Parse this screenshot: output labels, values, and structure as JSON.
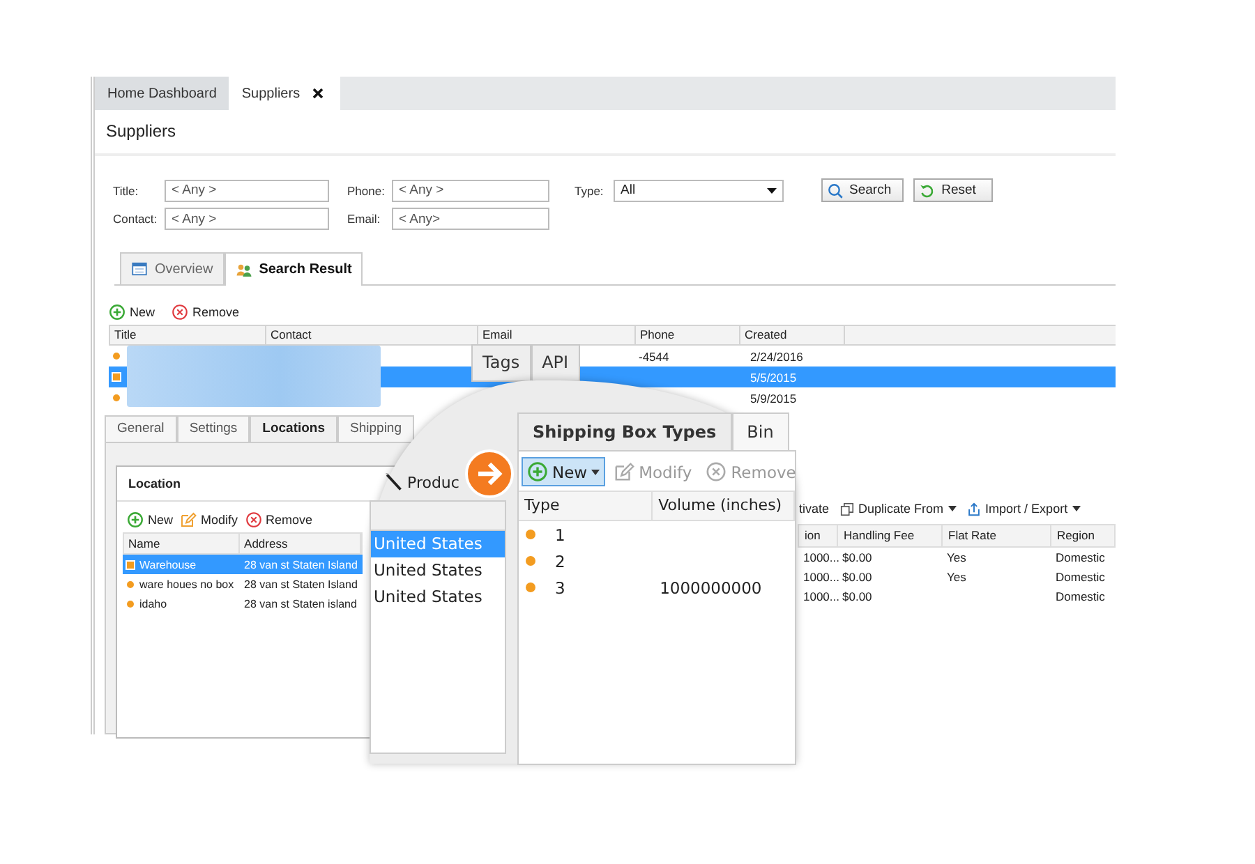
{
  "tabs": [
    {
      "label": "Home Dashboard",
      "selected": false
    },
    {
      "label": "Suppliers",
      "selected": true,
      "closable": true
    }
  ],
  "page_title": "Suppliers",
  "filters": [
    {
      "label": "Title:",
      "placeholder": "< Any >",
      "kind": "text"
    },
    {
      "label": "Phone:",
      "placeholder": "< Any >",
      "kind": "text"
    },
    {
      "label": "Type:",
      "value": "All",
      "kind": "select"
    },
    {
      "label": "Contact:",
      "placeholder": "< Any >",
      "kind": "text"
    },
    {
      "label": "Email:",
      "placeholder": "< Any>",
      "kind": "text"
    }
  ],
  "filter_buttons": [
    {
      "label": "Search",
      "kind": "search"
    },
    {
      "label": "Reset",
      "kind": "reset"
    }
  ],
  "view_tabs": [
    {
      "label": "Overview",
      "selected": false,
      "kind": "calendar"
    },
    {
      "label": "Search Result",
      "selected": true,
      "kind": "people"
    }
  ],
  "result_toolbar": [
    {
      "label": "New",
      "kind": "add"
    },
    {
      "label": "Remove",
      "kind": "remove"
    }
  ],
  "results": {
    "columns": [
      "Title",
      "Contact",
      "Email",
      "Phone",
      "Created"
    ],
    "rows": [
      {
        "phone": "-4544",
        "created": "2/24/2016",
        "selected": false
      },
      {
        "created": "5/5/2015",
        "selected": true
      },
      {
        "created": "5/9/2015",
        "selected": false
      }
    ]
  },
  "detail_tabs": [
    {
      "label": "General",
      "selected": false
    },
    {
      "label": "Settings",
      "selected": false
    },
    {
      "label": "Locations",
      "selected": true
    },
    {
      "label": "Shipping",
      "selected": false
    }
  ],
  "location_panel": {
    "title": "Location",
    "toolbar": [
      {
        "label": "New",
        "kind": "add"
      },
      {
        "label": "Modify",
        "kind": "edit"
      },
      {
        "label": "Remove",
        "kind": "remove"
      }
    ],
    "columns": [
      "Name",
      "Address"
    ],
    "rows": [
      {
        "name": "Warehouse",
        "address": "28 van st Staten Island",
        "selected": true
      },
      {
        "name": "ware houes no box",
        "address": "28 van st Staten Island",
        "selected": false
      },
      {
        "name": "idaho",
        "address": "28 van st Staten island",
        "selected": false
      }
    ]
  },
  "box_panel": {
    "toolbar": [
      {
        "label": "tivate",
        "kind": "plain"
      },
      {
        "label": "Duplicate From",
        "kind": "duplicate",
        "dropdown": true
      },
      {
        "label": "Import / Export",
        "kind": "import",
        "dropdown": true
      }
    ],
    "columns": [
      "ion",
      "Handling Fee",
      "Flat Rate",
      "Region"
    ],
    "rows": [
      {
        "column_1": "1000...",
        "handling_fee": "$0.00",
        "flat_rate": "Yes",
        "region": "Domestic"
      },
      {
        "column_1": "1000...",
        "handling_fee": "$0.00",
        "flat_rate": "Yes",
        "region": "Domestic"
      },
      {
        "column_1": "1000...",
        "handling_fee": "$0.00",
        "region": "Domestic"
      }
    ]
  },
  "magnifier": {
    "tabs": [
      {
        "label": "Tags",
        "selected": false
      },
      {
        "label": "API",
        "selected": false
      }
    ],
    "products_label": "Produc",
    "countries": [
      {
        "label": "United States",
        "selected": true
      },
      {
        "label": "United States",
        "selected": false
      },
      {
        "label": "United States",
        "selected": false
      }
    ],
    "box_tabs": [
      {
        "label": "Shipping Box Types",
        "selected": true
      },
      {
        "label": "Bin",
        "selected": false
      }
    ],
    "toolbar": [
      {
        "label": "New",
        "kind": "add",
        "dropdown": true,
        "highlighted": true
      },
      {
        "label": "Modify",
        "kind": "edit",
        "disabled": true
      },
      {
        "label": "Remove",
        "kind": "remove",
        "disabled": true
      }
    ],
    "columns": [
      "Type",
      "Volume (inches)"
    ],
    "rows": [
      {
        "type": "1"
      },
      {
        "type": "2"
      },
      {
        "type": "3",
        "volume": "1000000000"
      }
    ]
  }
}
